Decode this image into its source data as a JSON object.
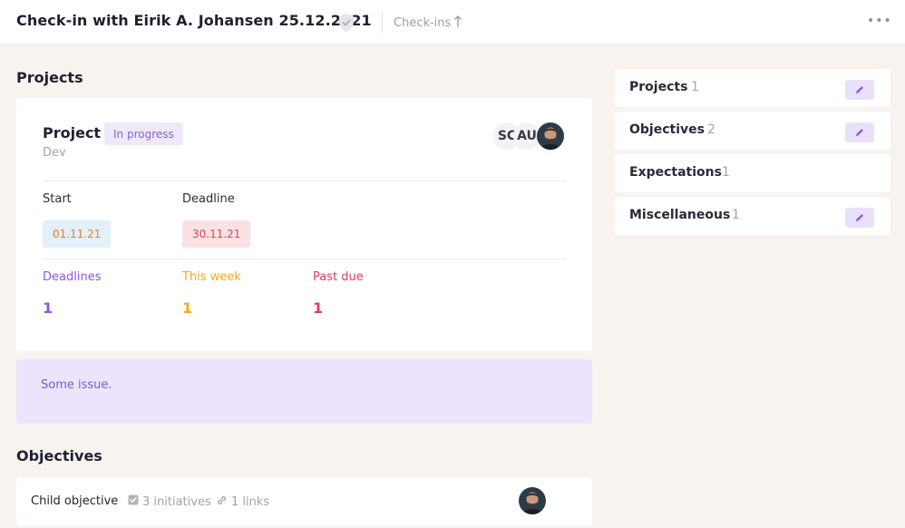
{
  "header": {
    "title": "Check-in with Eirik A. Johansen 25.12.2021",
    "breadcrumb": "Check-ins",
    "more_label": "•••"
  },
  "projects_section": {
    "title": "Projects",
    "project": {
      "name": "Project",
      "status": "In progress",
      "category": "Dev",
      "avatars": [
        "SC",
        "AU"
      ],
      "start_label": "Start",
      "start_date": "01.11.21",
      "deadline_label": "Deadline",
      "deadline_date": "30.11.21",
      "stats": [
        {
          "label": "Deadlines",
          "value": "1",
          "color": "#8a57e6"
        },
        {
          "label": "This week",
          "value": "1",
          "color": "#f1a81f"
        },
        {
          "label": "Past due",
          "value": "1",
          "color": "#e23b63"
        }
      ]
    },
    "issue_text": "Some issue."
  },
  "objectives_section": {
    "title": "Objectives",
    "items": [
      {
        "name": "Child objective",
        "initiatives": "3 initiatives",
        "links": "1 links"
      }
    ]
  },
  "sidebar": {
    "items": [
      {
        "label": "Projects",
        "count": "1",
        "editable": true
      },
      {
        "label": "Objectives",
        "count": "2",
        "editable": true
      },
      {
        "label": "Expectations",
        "count": "1",
        "editable": false
      },
      {
        "label": "Miscellaneous",
        "count": "1",
        "editable": true
      }
    ]
  },
  "colors": {
    "accent": "#8a57e6",
    "background": "#f8f3ef",
    "start_chip_bg": "#e3effa",
    "start_chip_fg": "#e57f23",
    "deadline_chip_bg": "#fbe1e3",
    "deadline_chip_fg": "#dd4459"
  }
}
